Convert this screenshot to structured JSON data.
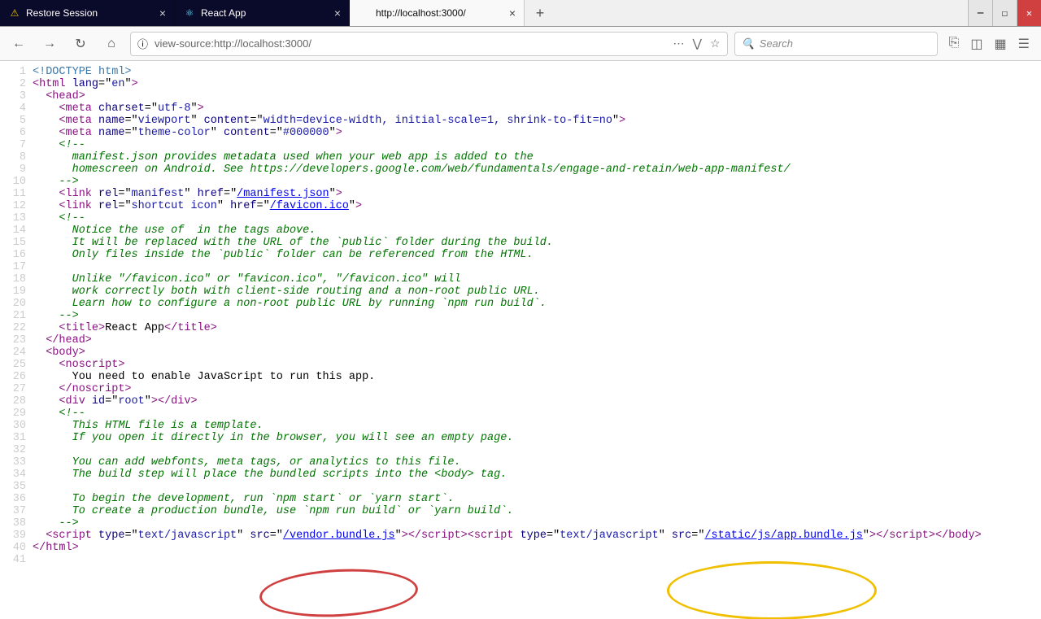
{
  "tabs": [
    {
      "icon": "⚠",
      "label": "Restore Session"
    },
    {
      "icon": "⚛",
      "label": "React App"
    },
    {
      "icon": "",
      "label": "http://localhost:3000/"
    }
  ],
  "url": "view-source:http://localhost:3000/",
  "search_placeholder": "Search",
  "source_lines": [
    {
      "n": "1",
      "html": "<span class='pi'>&lt;!DOCTYPE html&gt;</span>"
    },
    {
      "n": "2",
      "html": "<span class='tagc'>&lt;html</span> <span class='attr'>lang</span>=\"<span class='val'>en</span>\"<span class='tagc'>&gt;</span>"
    },
    {
      "n": "3",
      "html": "  <span class='tagc'>&lt;head&gt;</span>"
    },
    {
      "n": "4",
      "html": "    <span class='tagc'>&lt;meta</span> <span class='attr'>charset</span>=\"<span class='val'>utf-8</span>\"<span class='tagc'>&gt;</span>"
    },
    {
      "n": "5",
      "html": "    <span class='tagc'>&lt;meta</span> <span class='attr'>name</span>=\"<span class='val'>viewport</span>\" <span class='attr'>content</span>=\"<span class='val'>width=device-width, initial-scale=1, shrink-to-fit=no</span>\"<span class='tagc'>&gt;</span>"
    },
    {
      "n": "6",
      "html": "    <span class='tagc'>&lt;meta</span> <span class='attr'>name</span>=\"<span class='val'>theme-color</span>\" <span class='attr'>content</span>=\"<span class='val'>#000000</span>\"<span class='tagc'>&gt;</span>"
    },
    {
      "n": "7",
      "html": "    <span class='cmt'>&lt;!--</span>"
    },
    {
      "n": "8",
      "html": "<span class='cmt'>      manifest.json provides metadata used when your web app is added to the</span>"
    },
    {
      "n": "9",
      "html": "<span class='cmt'>      homescreen on Android. See https://developers.google.com/web/fundamentals/engage-and-retain/web-app-manifest/</span>"
    },
    {
      "n": "10",
      "html": "<span class='cmt'>    --&gt;</span>"
    },
    {
      "n": "11",
      "html": "    <span class='tagc'>&lt;link</span> <span class='attr'>rel</span>=\"<span class='val'>manifest</span>\" <span class='attr'>href</span>=\"<span class='lnk'>/manifest.json</span>\"<span class='tagc'>&gt;</span>"
    },
    {
      "n": "12",
      "html": "    <span class='tagc'>&lt;link</span> <span class='attr'>rel</span>=\"<span class='val'>shortcut icon</span>\" <span class='attr'>href</span>=\"<span class='lnk'>/favicon.ico</span>\"<span class='tagc'>&gt;</span>"
    },
    {
      "n": "13",
      "html": "    <span class='cmt'>&lt;!--</span>"
    },
    {
      "n": "14",
      "html": "<span class='cmt'>      Notice the use of  in the tags above.</span>"
    },
    {
      "n": "15",
      "html": "<span class='cmt'>      It will be replaced with the URL of the `public` folder during the build.</span>"
    },
    {
      "n": "16",
      "html": "<span class='cmt'>      Only files inside the `public` folder can be referenced from the HTML.</span>"
    },
    {
      "n": "17",
      "html": ""
    },
    {
      "n": "18",
      "html": "<span class='cmt'>      Unlike \"/favicon.ico\" or \"favicon.ico\", \"/favicon.ico\" will</span>"
    },
    {
      "n": "19",
      "html": "<span class='cmt'>      work correctly both with client-side routing and a non-root public URL.</span>"
    },
    {
      "n": "20",
      "html": "<span class='cmt'>      Learn how to configure a non-root public URL by running `npm run build`.</span>"
    },
    {
      "n": "21",
      "html": "<span class='cmt'>    --&gt;</span>"
    },
    {
      "n": "22",
      "html": "    <span class='tagc'>&lt;title&gt;</span>React App<span class='tagc'>&lt;/title&gt;</span>"
    },
    {
      "n": "23",
      "html": "  <span class='tagc'>&lt;/head&gt;</span>"
    },
    {
      "n": "24",
      "html": "  <span class='tagc'>&lt;body&gt;</span>"
    },
    {
      "n": "25",
      "html": "    <span class='tagc'>&lt;noscript&gt;</span>"
    },
    {
      "n": "26",
      "html": "      You need to enable JavaScript to run this app."
    },
    {
      "n": "27",
      "html": "    <span class='tagc'>&lt;/noscript&gt;</span>"
    },
    {
      "n": "28",
      "html": "    <span class='tagc'>&lt;div</span> <span class='attr'>id</span>=\"<span class='val'>root</span>\"<span class='tagc'>&gt;&lt;/div&gt;</span>"
    },
    {
      "n": "29",
      "html": "    <span class='cmt'>&lt;!--</span>"
    },
    {
      "n": "30",
      "html": "<span class='cmt'>      This HTML file is a template.</span>"
    },
    {
      "n": "31",
      "html": "<span class='cmt'>      If you open it directly in the browser, you will see an empty page.</span>"
    },
    {
      "n": "32",
      "html": ""
    },
    {
      "n": "33",
      "html": "<span class='cmt'>      You can add webfonts, meta tags, or analytics to this file.</span>"
    },
    {
      "n": "34",
      "html": "<span class='cmt'>      The build step will place the bundled scripts into the &lt;body&gt; tag.</span>"
    },
    {
      "n": "35",
      "html": ""
    },
    {
      "n": "36",
      "html": "<span class='cmt'>      To begin the development, run `npm start` or `yarn start`.</span>"
    },
    {
      "n": "37",
      "html": "<span class='cmt'>      To create a production bundle, use `npm run build` or `yarn build`.</span>"
    },
    {
      "n": "38",
      "html": "<span class='cmt'>    --&gt;</span>"
    },
    {
      "n": "39",
      "html": "  <span class='tagc'>&lt;script</span> <span class='attr'>type</span>=\"<span class='val'>text/javascript</span>\" <span class='attr'>src</span>=\"<span class='lnk'>/vendor.bundle.js</span>\"<span class='tagc'>&gt;&lt;/script&gt;&lt;script</span> <span class='attr'>type</span>=\"<span class='val'>text/javascript</span>\" <span class='attr'>src</span>=\"<span class='lnk'>/static/js/app.bundle.js</span>\"<span class='tagc'>&gt;&lt;/script&gt;&lt;/body&gt;</span>"
    },
    {
      "n": "40",
      "html": "<span class='tagc'>&lt;/html&gt;</span>"
    },
    {
      "n": "41",
      "html": ""
    }
  ]
}
